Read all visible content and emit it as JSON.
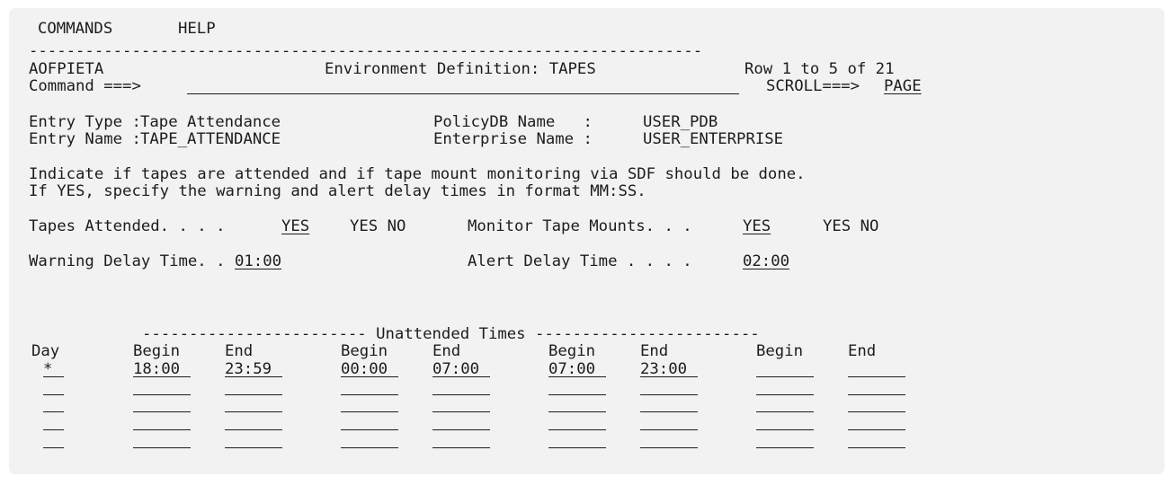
{
  "menu": {
    "commands": "COMMANDS",
    "help": "HELP"
  },
  "separator": "------------------------------------------------------------------------",
  "header": {
    "panel_id": "AOFPIETA",
    "title": "Environment Definition: TAPES",
    "row_info": "Row 1 to 5 of 21",
    "command_label": "Command ===>",
    "command_value": "",
    "scroll_label": "SCROLL===>",
    "scroll_value": "PAGE"
  },
  "entry": {
    "type_label": "Entry Type :",
    "type_value": "Tape Attendance",
    "name_label": "Entry Name :",
    "name_value": "TAPE_ATTENDANCE",
    "policydb_label": "PolicyDB Name   :",
    "policydb_value": "USER_PDB",
    "enterprise_label": "Enterprise Name :",
    "enterprise_value": "USER_ENTERPRISE"
  },
  "instructions": {
    "line1": "Indicate if tapes are attended and if tape mount monitoring via SDF should be done.",
    "line2": "If YES, specify the warning and alert delay times in format MM:SS."
  },
  "fields": {
    "tapes_attended_label": "Tapes Attended. . . .",
    "tapes_attended_value": "YES",
    "tapes_attended_options": "YES NO",
    "monitor_label": "Monitor Tape Mounts. . .",
    "monitor_value": "YES",
    "monitor_options": "YES NO",
    "warning_label": "Warning Delay Time. .",
    "warning_value": "01:00",
    "alert_label": "Alert Delay Time . . . .",
    "alert_value": "02:00"
  },
  "table": {
    "group_title": "------------------------ Unattended Times ------------------------",
    "headers": [
      "Day",
      "Begin",
      "End",
      "Begin",
      "End",
      "Begin",
      "End",
      "Begin",
      "End"
    ],
    "rows": [
      [
        "*",
        "18:00",
        "23:59",
        "00:00",
        "07:00",
        "07:00",
        "23:00",
        "",
        ""
      ],
      [
        "",
        "",
        "",
        "",
        "",
        "",
        "",
        "",
        ""
      ],
      [
        "",
        "",
        "",
        "",
        "",
        "",
        "",
        "",
        ""
      ],
      [
        "",
        "",
        "",
        "",
        "",
        "",
        "",
        "",
        ""
      ],
      [
        "",
        "",
        "",
        "",
        "",
        "",
        "",
        "",
        ""
      ]
    ]
  }
}
